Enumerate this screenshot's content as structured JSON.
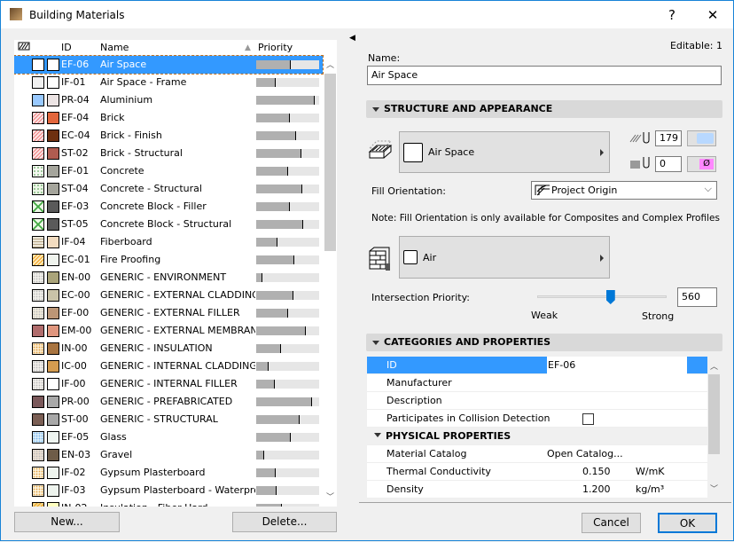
{
  "window": {
    "title": "Building Materials",
    "help": "?",
    "close": "✕"
  },
  "list": {
    "headers": {
      "id": "ID",
      "name": "Name",
      "priority": "Priority"
    },
    "rows": [
      {
        "id": "EF-06",
        "name": "Air Space",
        "priority": 0.55,
        "fill": "#ffffff",
        "surface": "#ffffff",
        "pattern": "none",
        "selected": true
      },
      {
        "id": "IF-01",
        "name": "Air Space - Frame",
        "priority": 0.31,
        "fill": "#f0f0f0",
        "surface": "#ffffff",
        "pattern": "none"
      },
      {
        "id": "PR-04",
        "name": "Aluminium",
        "priority": 0.93,
        "fill": "#99c9ff",
        "surface": "#ece4e4",
        "pattern": "none"
      },
      {
        "id": "EF-04",
        "name": "Brick",
        "priority": 0.54,
        "fill": "#fbe3e3",
        "surface": "#e2663c",
        "pattern": "hatch-red"
      },
      {
        "id": "EC-04",
        "name": "Brick - Finish",
        "priority": 0.64,
        "fill": "#fbe3e3",
        "surface": "#6e3010",
        "pattern": "hatch-red"
      },
      {
        "id": "ST-02",
        "name": "Brick - Structural",
        "priority": 0.72,
        "fill": "#fbe3e3",
        "surface": "#b05c50",
        "pattern": "hatch-red"
      },
      {
        "id": "EF-01",
        "name": "Concrete",
        "priority": 0.51,
        "fill": "#f4f8f0",
        "surface": "#a5a59c",
        "pattern": "dots-green"
      },
      {
        "id": "ST-04",
        "name": "Concrete - Structural",
        "priority": 0.73,
        "fill": "#eaf4e4",
        "surface": "#a5a59c",
        "pattern": "dots-green"
      },
      {
        "id": "EF-03",
        "name": "Concrete Block - Filler",
        "priority": 0.53,
        "fill": "#eaf8e4",
        "surface": "#5a5a5a",
        "pattern": "cross-green"
      },
      {
        "id": "ST-05",
        "name": "Concrete Block - Structural",
        "priority": 0.75,
        "fill": "#eaf8e4",
        "surface": "#5a5a5a",
        "pattern": "cross-green"
      },
      {
        "id": "IF-04",
        "name": "Fiberboard",
        "priority": 0.34,
        "fill": "#ece6d8",
        "surface": "#f2dcc0",
        "pattern": "lines-tan"
      },
      {
        "id": "EC-01",
        "name": "Fire Proofing",
        "priority": 0.61,
        "fill": "#fde8b8",
        "surface": "#f0f4ee",
        "pattern": "hatch-orange"
      },
      {
        "id": "EN-00",
        "name": "GENERIC - ENVIRONMENT",
        "priority": 0.1,
        "fill": "#efede8",
        "surface": "#aaa47a",
        "pattern": "dots-grey"
      },
      {
        "id": "EC-00",
        "name": "GENERIC - EXTERNAL CLADDING",
        "priority": 0.59,
        "fill": "#efede8",
        "surface": "#c9c3a8",
        "pattern": "dots-grey"
      },
      {
        "id": "EF-00",
        "name": "GENERIC - EXTERNAL FILLER",
        "priority": 0.5,
        "fill": "#ede8da",
        "surface": "#bc9676",
        "pattern": "dots-grey"
      },
      {
        "id": "EM-00",
        "name": "GENERIC - EXTERNAL MEMBRANE",
        "priority": 0.79,
        "fill": "#e0c0c0",
        "surface": "#e0967e",
        "pattern": "dots-red"
      },
      {
        "id": "IN-00",
        "name": "GENERIC - INSULATION",
        "priority": 0.39,
        "fill": "#f8e6c8",
        "surface": "#a87440",
        "pattern": "dots-orange"
      },
      {
        "id": "IC-00",
        "name": "GENERIC - INTERNAL CLADDING",
        "priority": 0.2,
        "fill": "#efece8",
        "surface": "#d49c50",
        "pattern": "dots-grey"
      },
      {
        "id": "IF-00",
        "name": "GENERIC - INTERNAL FILLER",
        "priority": 0.3,
        "fill": "#efece8",
        "surface": "#ffffff",
        "pattern": "dots-grey"
      },
      {
        "id": "PR-00",
        "name": "GENERIC - PREFABRICATED",
        "priority": 0.89,
        "fill": "#c8a0a8",
        "surface": "#a8a8a8",
        "pattern": "dots-dark"
      },
      {
        "id": "ST-00",
        "name": "GENERIC - STRUCTURAL",
        "priority": 0.69,
        "fill": "#c8b890",
        "surface": "#a8a8a8",
        "pattern": "dots-dark"
      },
      {
        "id": "EF-05",
        "name": "Glass",
        "priority": 0.55,
        "fill": "#d8ecf8",
        "surface": "#eef4f0",
        "pattern": "dots-blue"
      },
      {
        "id": "EN-03",
        "name": "Gravel",
        "priority": 0.13,
        "fill": "#e8dcd0",
        "surface": "#6e5c48",
        "pattern": "dots-grey"
      },
      {
        "id": "IF-02",
        "name": "Gypsum Plasterboard",
        "priority": 0.31,
        "fill": "#fbf0d8",
        "surface": "#eef4ee",
        "pattern": "dots-orange"
      },
      {
        "id": "IF-03",
        "name": "Gypsum Plasterboard - Waterproof",
        "priority": 0.32,
        "fill": "#fbf0d8",
        "surface": "#eef4ee",
        "pattern": "dots-orange"
      },
      {
        "id": "IN-02",
        "name": "Insulation - Fiber Hard",
        "priority": 0.41,
        "fill": "#f0d890",
        "surface": "#ffffc0",
        "pattern": "hatch-orange"
      }
    ],
    "new_button": "New...",
    "delete_button": "Delete..."
  },
  "editor": {
    "editable": "Editable: 1",
    "name_label": "Name:",
    "name_value": "Air Space",
    "structure_section": "STRUCTURE AND APPEARANCE",
    "cut_fill": "Air Space",
    "fill_pen": "179",
    "bg_pen": "0",
    "bg_color_symbol": "Ø",
    "fill_orientation_label": "Fill Orientation:",
    "fill_orientation_value": "Project Origin",
    "note": "Note: Fill Orientation is only available for Composites and Complex Profiles",
    "surface": "Air",
    "priority_label": "Intersection Priority:",
    "priority_value": "560",
    "priority_fraction": 0.56,
    "weak": "Weak",
    "strong": "Strong",
    "categories_section": "CATEGORIES AND PROPERTIES",
    "properties": [
      {
        "label": "ID",
        "value": "EF-06",
        "unit": "",
        "selected": true
      },
      {
        "label": "Manufacturer",
        "value": "",
        "unit": ""
      },
      {
        "label": "Description",
        "value": "",
        "unit": ""
      },
      {
        "label": "Participates in Collision Detection",
        "value": "",
        "unit": "",
        "checkbox": false
      }
    ],
    "physical_section": "PHYSICAL PROPERTIES",
    "physical": [
      {
        "label": "Material Catalog",
        "value": "Open Catalog...",
        "unit": ""
      },
      {
        "label": "Thermal Conductivity",
        "value": "0.150",
        "unit": "W/mK"
      },
      {
        "label": "Density",
        "value": "1.200",
        "unit": "kg/m³"
      }
    ],
    "cancel": "Cancel",
    "ok": "OK"
  },
  "colors": {
    "accent": "#3399ff",
    "selection": "#3399ff",
    "window_border": "#1883d7",
    "ok_border": "#0078d7",
    "bg_pen_color": "#b8d8ff",
    "none_color": "#ff88ff"
  }
}
